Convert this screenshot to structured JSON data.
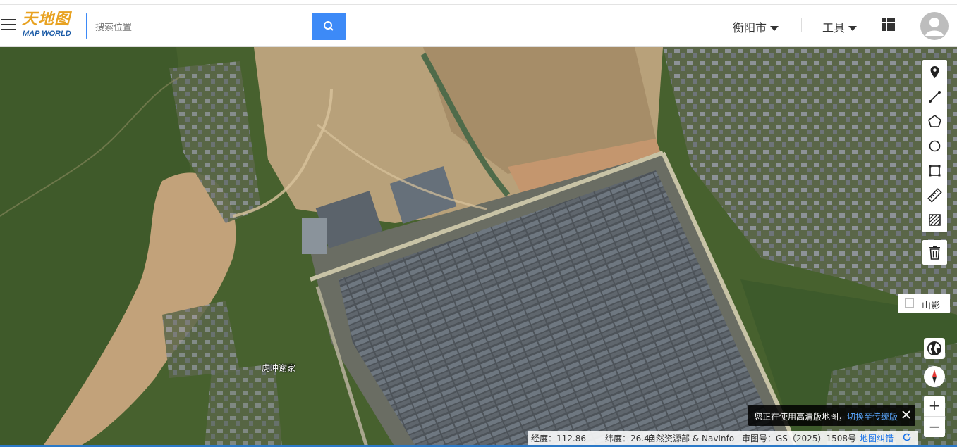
{
  "header": {
    "logo_cn": "天地图",
    "logo_en": "MAP WORLD",
    "search_placeholder": "搜索位置",
    "city": "衡阳市",
    "tools_label": "工具"
  },
  "map": {
    "place_label": "虎冲谢家"
  },
  "right_panel": {
    "tools": [
      "marker-icon",
      "line-icon",
      "polygon-icon",
      "circle-icon",
      "rectangle-icon",
      "ruler-icon",
      "hatch-area-icon"
    ],
    "hillshade_label": "山影"
  },
  "notice": {
    "text": "您正在使用高清版地图，",
    "link": "切换至传统版"
  },
  "status": {
    "lon": "经度：112.86",
    "lat": "纬度：26.47",
    "source": "自然资源部 & NavInfo",
    "approval": "审图号：GS（2025）1508号",
    "error_report": "地图纠错"
  },
  "colors": {
    "accent": "#3d8af7",
    "logo_orange": "#e8a221",
    "logo_blue": "#1a5aa6"
  }
}
